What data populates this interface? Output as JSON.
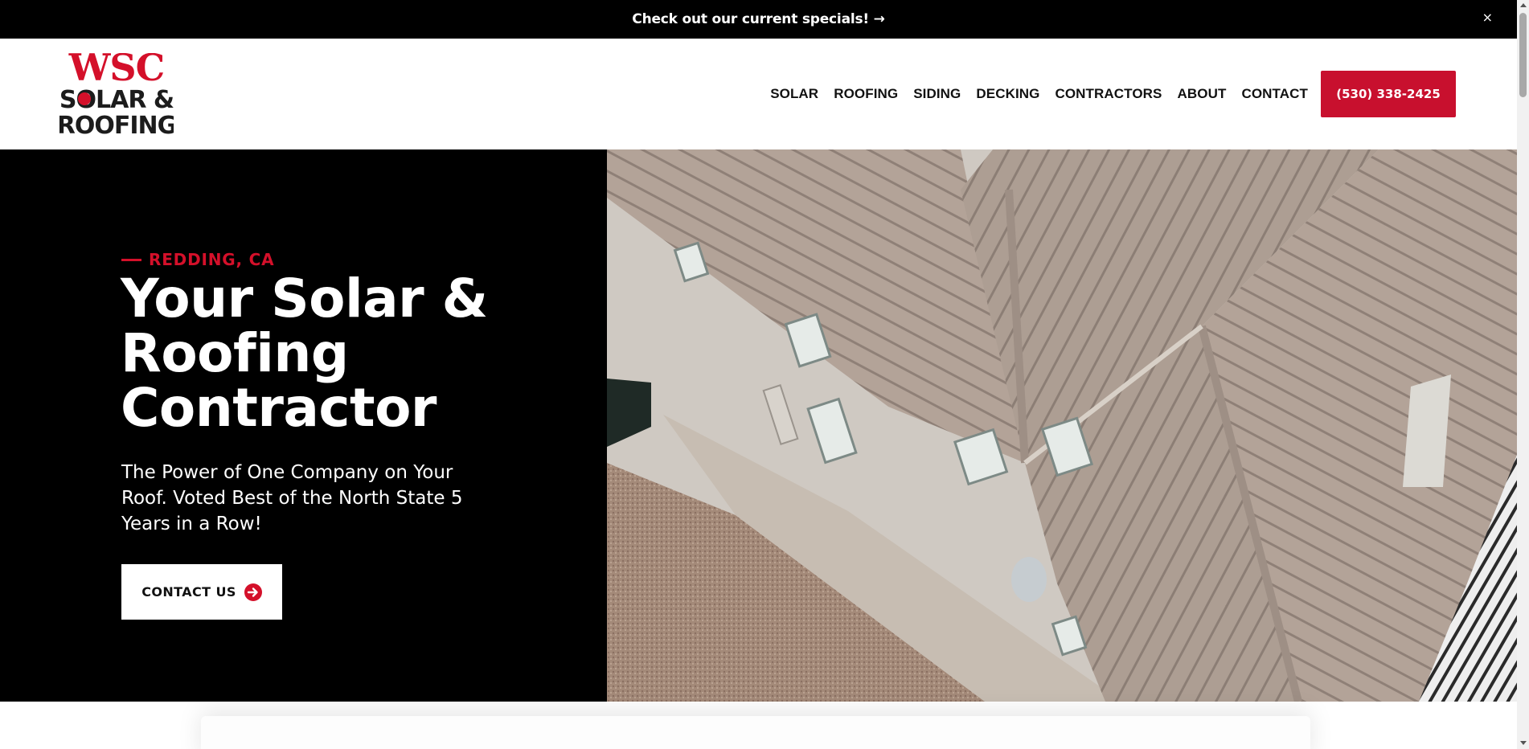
{
  "promo": {
    "text": "Check out our current specials! →",
    "close": "×"
  },
  "logo": {
    "line1": "WSC",
    "line2": "SOLAR &",
    "line3": "ROOFING",
    "brand_red": "#d4102a"
  },
  "nav": {
    "items": [
      "SOLAR",
      "ROOFING",
      "SIDING",
      "DECKING",
      "CONTRACTORS",
      "ABOUT",
      "CONTACT"
    ],
    "phone": "(530) 338-2425"
  },
  "hero": {
    "eyebrow": "REDDING, CA",
    "headline": "Your Solar & Roofing Contractor",
    "subtext": "The Power of One Company on Your Roof. Voted Best of the North State 5 Years in a Row!",
    "cta": "CONTACT US",
    "cta_icon": "arrow-circle-right-icon"
  },
  "colors": {
    "accent": "#c8102e",
    "background_dark": "#000000"
  }
}
